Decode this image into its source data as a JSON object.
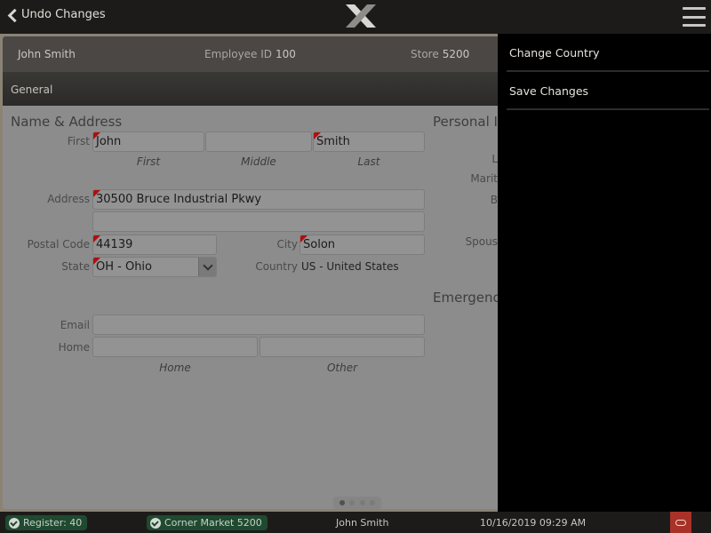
{
  "topbar": {
    "back_label": "Undo Changes",
    "logo_icon": "x-logo",
    "menu_icon": "hamburger-icon"
  },
  "employee": {
    "name": "John Smith",
    "employee_id_label": "Employee ID",
    "employee_id": "100",
    "store_label": "Store",
    "store": "5200"
  },
  "tab": {
    "label": "General"
  },
  "name_address": {
    "title": "Name & Address",
    "first_label": "First",
    "first_value": "John",
    "middle_value": "",
    "last_value": "Smith",
    "sub_first": "First",
    "sub_middle": "Middle",
    "sub_last": "Last",
    "address_label": "Address",
    "address1": "30500 Bruce Industrial Pkwy",
    "address2": "",
    "postal_label": "Postal Code",
    "postal_value": "44139",
    "city_label": "City",
    "city_value": "Solon",
    "state_label": "State",
    "state_value": "OH - Ohio",
    "country_label": "Country",
    "country_value": "US - United States",
    "email_label": "Email",
    "email_value": "",
    "home_label": "Home",
    "phone_home": "",
    "phone_other": "",
    "sub_home": "Home",
    "sub_other": "Other"
  },
  "personal_info": {
    "title": "Personal In",
    "labels": [
      "L",
      "Marit",
      "B",
      "Spous"
    ]
  },
  "emergency": {
    "title": "Emergency"
  },
  "pager": {
    "pages": 4,
    "current": 1
  },
  "menu": {
    "items": [
      {
        "label": "Change Country"
      },
      {
        "label": "Save Changes"
      }
    ]
  },
  "statusbar": {
    "register": "Register: 40",
    "store": "Corner Market 5200",
    "user": "John Smith",
    "datetime": "10/16/2019 09:29 AM",
    "oracle_icon": "oracle-icon"
  },
  "colors": {
    "required_marker": "#b00e0e",
    "status_pill": "#1f4a30",
    "oracle_button": "#a83228"
  }
}
